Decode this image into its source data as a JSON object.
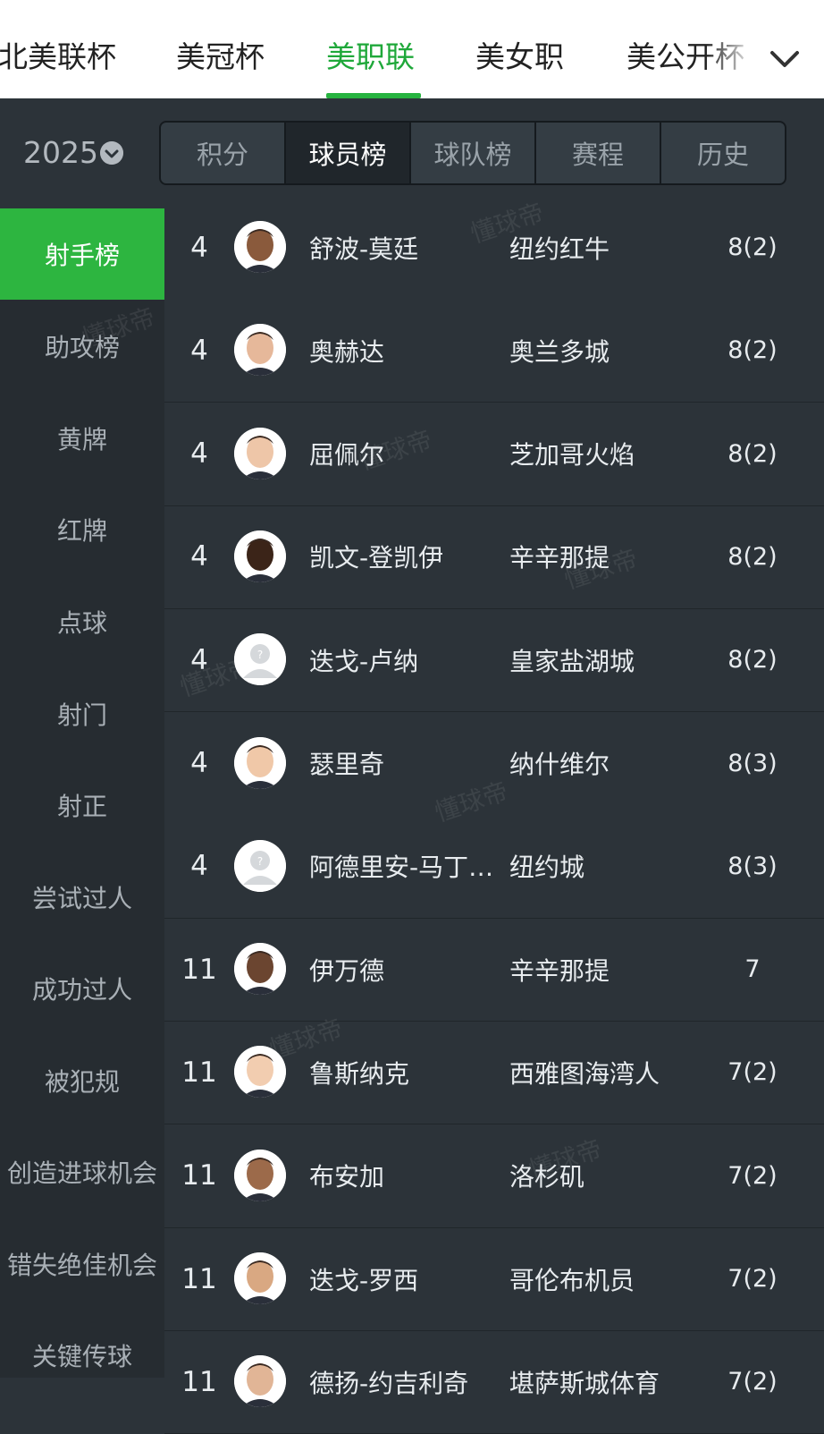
{
  "top_tabs": [
    "北美联杯",
    "美冠杯",
    "美职联",
    "美女职",
    "美公开杯"
  ],
  "active_tab": "美职联",
  "season": "2025",
  "sub_tabs": [
    "积分",
    "球员榜",
    "球队榜",
    "赛程",
    "历史"
  ],
  "active_sub_tab": "球员榜",
  "sidebar": [
    "射手榜",
    "助攻榜",
    "黄牌",
    "红牌",
    "点球",
    "射门",
    "射正",
    "尝试过人",
    "成功过人",
    "被犯规",
    "创造进球机会",
    "错失绝佳机会",
    "关键传球"
  ],
  "active_sidebar": "射手榜",
  "rows": [
    {
      "rank": "4",
      "name": "舒波-莫廷",
      "team": "纽约红牛",
      "goals": "8(2)",
      "avatar": "player-photo"
    },
    {
      "rank": "4",
      "name": "奥赫达",
      "team": "奥兰多城",
      "goals": "8(2)",
      "avatar": "player-photo"
    },
    {
      "rank": "4",
      "name": "屈佩尔",
      "team": "芝加哥火焰",
      "goals": "8(2)",
      "avatar": "player-photo"
    },
    {
      "rank": "4",
      "name": "凯文-登凯伊",
      "team": "辛辛那提",
      "goals": "8(2)",
      "avatar": "player-photo"
    },
    {
      "rank": "4",
      "name": "迭戈-卢纳",
      "team": "皇家盐湖城",
      "goals": "8(2)",
      "avatar": "placeholder"
    },
    {
      "rank": "4",
      "name": "瑟里奇",
      "team": "纳什维尔",
      "goals": "8(3)",
      "avatar": "player-photo"
    },
    {
      "rank": "4",
      "name": "阿德里安-马丁…",
      "team": "纽约城",
      "goals": "8(3)",
      "avatar": "placeholder"
    },
    {
      "rank": "11",
      "name": "伊万德",
      "team": "辛辛那提",
      "goals": "7",
      "avatar": "player-photo"
    },
    {
      "rank": "11",
      "name": "鲁斯纳克",
      "team": "西雅图海湾人",
      "goals": "7(2)",
      "avatar": "player-photo"
    },
    {
      "rank": "11",
      "name": "布安加",
      "team": "洛杉矶",
      "goals": "7(2)",
      "avatar": "player-photo"
    },
    {
      "rank": "11",
      "name": "迭戈-罗西",
      "team": "哥伦布机员",
      "goals": "7(2)",
      "avatar": "player-photo"
    },
    {
      "rank": "11",
      "name": "德扬-约吉利奇",
      "team": "堪萨斯城体育",
      "goals": "7(2)",
      "avatar": "player-photo"
    }
  ],
  "watermark": "懂球帝",
  "colors": {
    "accent": "#2db540",
    "background": "#2c3339",
    "sidebar": "#262c31"
  }
}
